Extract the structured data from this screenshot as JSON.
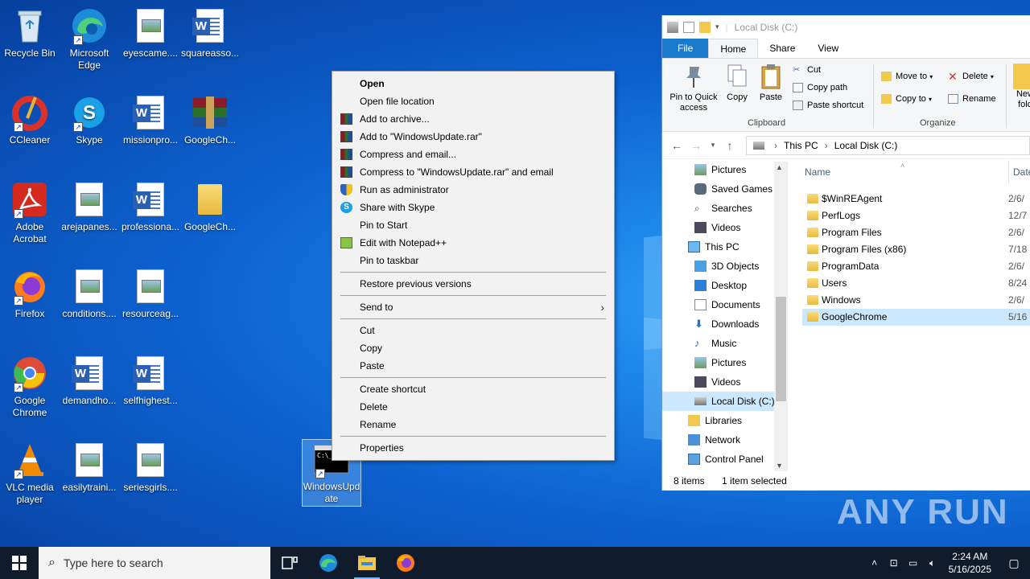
{
  "desktop": {
    "icons": [
      {
        "label": "Recycle Bin"
      },
      {
        "label": "Microsoft Edge"
      },
      {
        "label": "eyescame...."
      },
      {
        "label": "squareasso..."
      },
      {
        "label": "CCleaner"
      },
      {
        "label": "Skype"
      },
      {
        "label": "missionpro..."
      },
      {
        "label": "GoogleCh..."
      },
      {
        "label": "Adobe Acrobat"
      },
      {
        "label": "arejapanes..."
      },
      {
        "label": "professiona..."
      },
      {
        "label": "GoogleCh..."
      },
      {
        "label": "Firefox"
      },
      {
        "label": "conditions...."
      },
      {
        "label": "resourceag..."
      },
      {
        "label": "Google Chrome"
      },
      {
        "label": "demandho..."
      },
      {
        "label": "selfhighest..."
      },
      {
        "label": "VLC media player"
      },
      {
        "label": "easilytraini..."
      },
      {
        "label": "seriesgirls...."
      },
      {
        "label": "WindowsUpdate"
      }
    ]
  },
  "context_menu": {
    "items": [
      {
        "label": "Open"
      },
      {
        "label": "Open file location"
      },
      {
        "label": "Add to archive..."
      },
      {
        "label": "Add to \"WindowsUpdate.rar\""
      },
      {
        "label": "Compress and email..."
      },
      {
        "label": "Compress to \"WindowsUpdate.rar\" and email"
      },
      {
        "label": "Run as administrator"
      },
      {
        "label": "Share with Skype"
      },
      {
        "label": "Pin to Start"
      },
      {
        "label": "Edit with Notepad++"
      },
      {
        "label": "Pin to taskbar"
      },
      {
        "label": "Restore previous versions"
      },
      {
        "label": "Send to"
      },
      {
        "label": "Cut"
      },
      {
        "label": "Copy"
      },
      {
        "label": "Paste"
      },
      {
        "label": "Create shortcut"
      },
      {
        "label": "Delete"
      },
      {
        "label": "Rename"
      },
      {
        "label": "Properties"
      }
    ]
  },
  "explorer": {
    "title": "Local Disk (C:)",
    "tabs": [
      "File",
      "Home",
      "Share",
      "View"
    ],
    "ribbon": {
      "pin_label": "Pin to Quick access",
      "copy_label": "Copy",
      "paste_label": "Paste",
      "cut_label": "Cut",
      "copy_path_label": "Copy path",
      "paste_shortcut_label": "Paste shortcut",
      "clipboard_group": "Clipboard",
      "move_to_label": "Move to",
      "copy_to_label": "Copy to",
      "delete_label": "Delete",
      "rename_label": "Rename",
      "organize_group": "Organize",
      "new_folder_label": "New fold"
    },
    "breadcrumb": [
      "This PC",
      "Local Disk (C:)"
    ],
    "nav_items": [
      {
        "label": "Pictures"
      },
      {
        "label": "Saved Games"
      },
      {
        "label": "Searches"
      },
      {
        "label": "Videos"
      },
      {
        "label": "This PC"
      },
      {
        "label": "3D Objects"
      },
      {
        "label": "Desktop"
      },
      {
        "label": "Documents"
      },
      {
        "label": "Downloads"
      },
      {
        "label": "Music"
      },
      {
        "label": "Pictures"
      },
      {
        "label": "Videos"
      },
      {
        "label": "Local Disk (C:)"
      },
      {
        "label": "Libraries"
      },
      {
        "label": "Network"
      },
      {
        "label": "Control Panel"
      }
    ],
    "columns": {
      "name": "Name",
      "date": "Date"
    },
    "files": [
      {
        "name": "$WinREAgent",
        "date": "2/6/"
      },
      {
        "name": "PerfLogs",
        "date": "12/7"
      },
      {
        "name": "Program Files",
        "date": "2/6/"
      },
      {
        "name": "Program Files (x86)",
        "date": "7/18"
      },
      {
        "name": "ProgramData",
        "date": "2/6/"
      },
      {
        "name": "Users",
        "date": "8/24"
      },
      {
        "name": "Windows",
        "date": "2/6/"
      },
      {
        "name": "GoogleChrome",
        "date": "5/16"
      }
    ],
    "status": {
      "items": "8 items",
      "selected": "1 item selected"
    }
  },
  "taskbar": {
    "search_placeholder": "Type here to search",
    "time": "2:24 AM",
    "date": "5/16/2025"
  },
  "watermark": "ANY RUN"
}
